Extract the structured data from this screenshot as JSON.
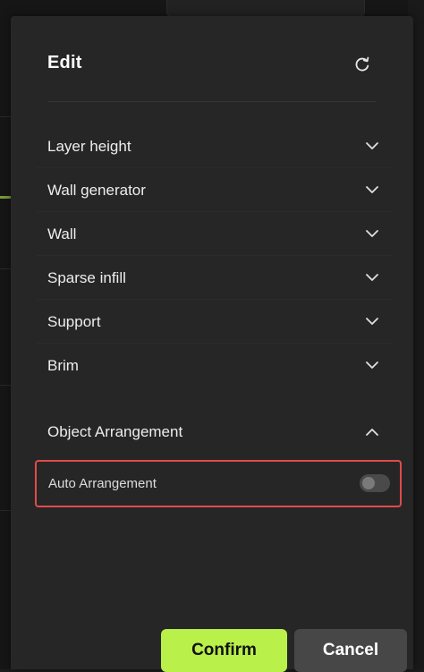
{
  "dialog": {
    "title": "Edit",
    "reset_icon": "reset-icon"
  },
  "sections": [
    {
      "label": "Layer height",
      "icon": "chevron-down-icon"
    },
    {
      "label": "Wall generator",
      "icon": "chevron-down-icon"
    },
    {
      "label": "Wall",
      "icon": "chevron-down-icon"
    },
    {
      "label": "Sparse infill",
      "icon": "chevron-down-icon"
    },
    {
      "label": "Support",
      "icon": "chevron-down-icon"
    },
    {
      "label": "Brim",
      "icon": "chevron-down-icon"
    }
  ],
  "object_arrangement": {
    "label": "Object Arrangement",
    "icon": "chevron-up-icon",
    "expanded": true,
    "options": {
      "auto_arrangement": {
        "label": "Auto Arrangement",
        "enabled": false
      }
    }
  },
  "footer": {
    "confirm_label": "Confirm",
    "cancel_label": "Cancel"
  },
  "colors": {
    "accent": "#b9f04a",
    "highlight_border": "#e04b4b",
    "dialog_bg": "#262626",
    "cancel_bg": "#474747"
  }
}
